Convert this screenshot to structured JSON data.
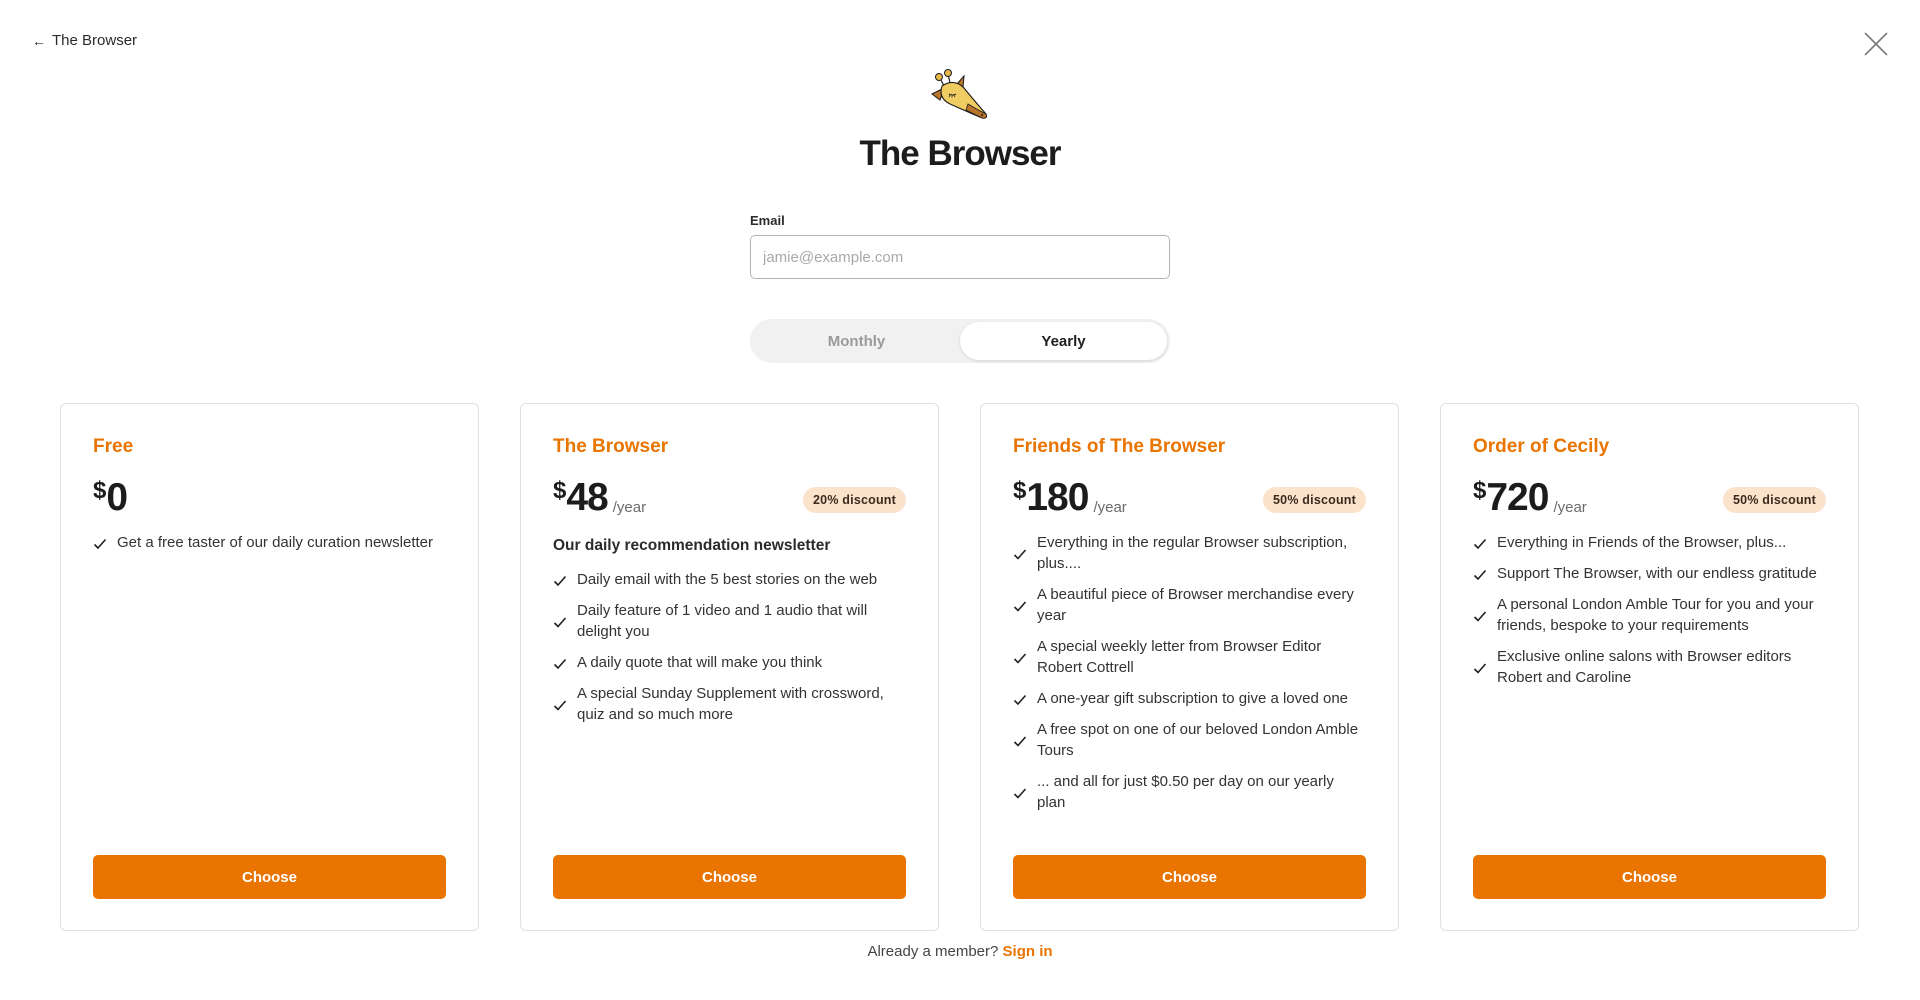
{
  "nav": {
    "back_label": "The Browser",
    "back_icon": "arrow-left-icon",
    "close_icon": "close-icon"
  },
  "brand": {
    "logo": "giraffe-logo",
    "title": "The Browser",
    "accent_color": "#e97400"
  },
  "email": {
    "label": "Email",
    "placeholder": "jamie@example.com",
    "value": ""
  },
  "billing_toggle": {
    "options": [
      "Monthly",
      "Yearly"
    ],
    "selected": "Yearly"
  },
  "plans": [
    {
      "name": "Free",
      "currency": "$",
      "amount": "0",
      "period": "",
      "discount": "",
      "subtitle": "",
      "features": [
        "Get a free taster of our daily curation newsletter"
      ],
      "button": "Choose"
    },
    {
      "name": "The Browser",
      "currency": "$",
      "amount": "48",
      "period": "/year",
      "discount": "20% discount",
      "subtitle": "Our daily recommendation newsletter",
      "features": [
        "Daily email with the 5 best stories on the web",
        "Daily feature of 1 video and 1 audio that will delight you",
        "A daily quote that will make you think",
        "A special Sunday Supplement with crossword, quiz and so much more"
      ],
      "button": "Choose"
    },
    {
      "name": "Friends of The Browser",
      "currency": "$",
      "amount": "180",
      "period": "/year",
      "discount": "50% discount",
      "subtitle": "",
      "features": [
        "Everything in the regular Browser subscription, plus....",
        "A beautiful piece of Browser merchandise every year",
        "A special weekly letter from Browser Editor Robert Cottrell",
        "A one-year gift subscription to give a loved one",
        "A free spot on one of our beloved London Amble Tours",
        "... and all for just $0.50 per day on our yearly plan"
      ],
      "button": "Choose"
    },
    {
      "name": "Order of Cecily",
      "currency": "$",
      "amount": "720",
      "period": "/year",
      "discount": "50% discount",
      "subtitle": "",
      "features": [
        "Everything in Friends of the Browser, plus...",
        "Support The Browser, with our endless gratitude",
        "A personal London Amble Tour for you and your friends, bespoke to your requirements",
        "Exclusive online salons with Browser editors Robert and Caroline"
      ],
      "button": "Choose"
    }
  ],
  "footer": {
    "prompt": "Already a member?",
    "link": "Sign in"
  }
}
